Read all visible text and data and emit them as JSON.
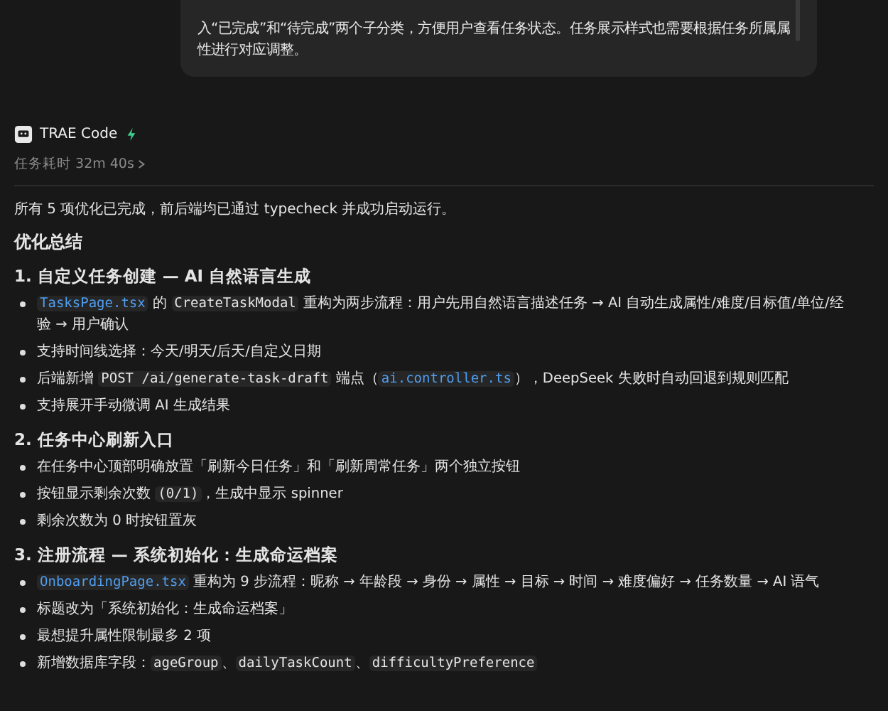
{
  "user_message": {
    "lines": [
      "入“已完成”和“待完成”两个子分类，方便用户查看任务状态。任务展示样式也需要根据任务所属属",
      "性进行对应调整。"
    ]
  },
  "agent": {
    "name": "TRAE Code",
    "duration": "任务耗时 32m 40s"
  },
  "response": {
    "intro": "所有 5 项优化已完成，前后端均已通过 typecheck 并成功启动运行。",
    "title": "优化总结",
    "sections": [
      {
        "heading": "1. 自定义任务创建 — AI 自然语言生成",
        "bullets": [
          [
            {
              "kind": "file",
              "text": "TasksPage.tsx"
            },
            {
              "kind": "text",
              "text": " 的 "
            },
            {
              "kind": "code",
              "text": "CreateTaskModal"
            },
            {
              "kind": "text",
              "text": " 重构为两步流程：用户先用自然语言描述任务 → AI 自动生成属性/难度/目标值/单位/经验 → 用户确认"
            }
          ],
          [
            {
              "kind": "text",
              "text": "支持时间线选择：今天/明天/后天/自定义日期"
            }
          ],
          [
            {
              "kind": "text",
              "text": "后端新增 "
            },
            {
              "kind": "code",
              "text": "POST /ai/generate-task-draft"
            },
            {
              "kind": "text",
              "text": " 端点（"
            },
            {
              "kind": "file",
              "text": "ai.controller.ts"
            },
            {
              "kind": "text",
              "text": "），DeepSeek 失败时自动回退到规则匹配"
            }
          ],
          [
            {
              "kind": "text",
              "text": "支持展开手动微调 AI 生成结果"
            }
          ]
        ]
      },
      {
        "heading": "2. 任务中心刷新入口",
        "bullets": [
          [
            {
              "kind": "text",
              "text": "在任务中心顶部明确放置「刷新今日任务」和「刷新周常任务」两个独立按钮"
            }
          ],
          [
            {
              "kind": "text",
              "text": "按钮显示剩余次数 "
            },
            {
              "kind": "code",
              "text": "(0/1)"
            },
            {
              "kind": "text",
              "text": "，生成中显示 spinner"
            }
          ],
          [
            {
              "kind": "text",
              "text": "剩余次数为 0 时按钮置灰"
            }
          ]
        ]
      },
      {
        "heading": "3. 注册流程 — 系统初始化：生成命运档案",
        "bullets": [
          [
            {
              "kind": "file",
              "text": "OnboardingPage.tsx"
            },
            {
              "kind": "text",
              "text": " 重构为 9 步流程：昵称 → 年龄段 → 身份 → 属性 → 目标 → 时间 → 难度偏好 → 任务数量 → AI 语气"
            }
          ],
          [
            {
              "kind": "text",
              "text": "标题改为「系统初始化：生成命运档案」"
            }
          ],
          [
            {
              "kind": "text",
              "text": "最想提升属性限制最多 2 项"
            }
          ],
          [
            {
              "kind": "text",
              "text": "新增数据库字段："
            },
            {
              "kind": "code",
              "text": "ageGroup"
            },
            {
              "kind": "text",
              "text": "、"
            },
            {
              "kind": "code",
              "text": "dailyTaskCount"
            },
            {
              "kind": "text",
              "text": "、"
            },
            {
              "kind": "code",
              "text": "difficultyPreference"
            }
          ]
        ]
      }
    ]
  }
}
